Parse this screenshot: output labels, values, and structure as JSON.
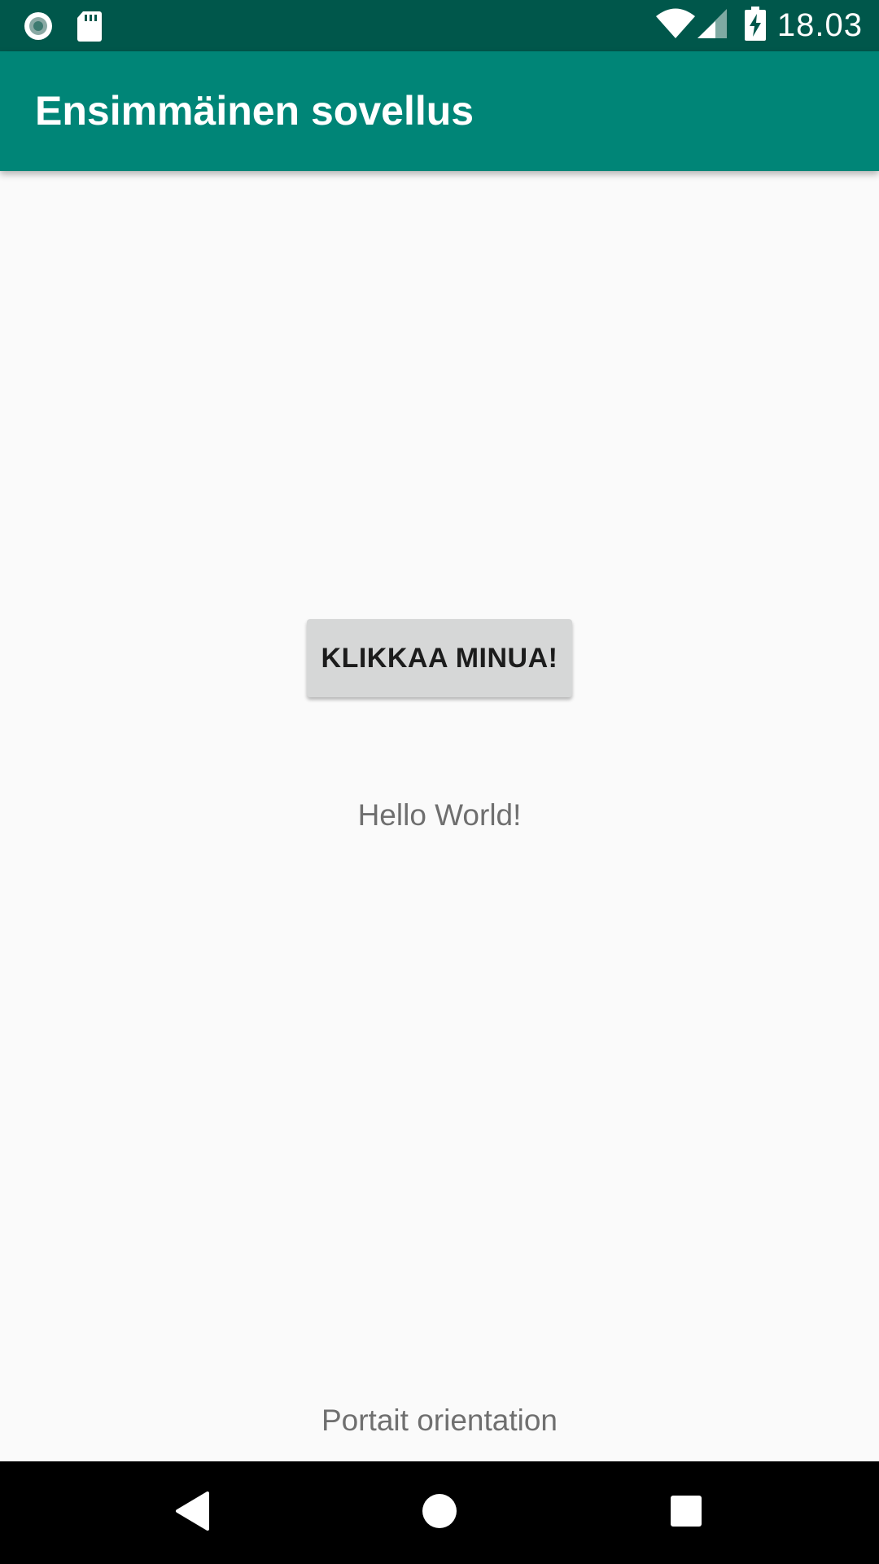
{
  "status_bar": {
    "time": "18.03",
    "left_icons": [
      "radio-button-icon",
      "sd-card-icon"
    ],
    "right_icons": [
      "wifi-icon",
      "signal-icon",
      "battery-charging-icon"
    ],
    "background": "#00574b"
  },
  "app_bar": {
    "title": "Ensimmäinen sovellus",
    "background": "#008577"
  },
  "main": {
    "button_label": "KLIKKAA MINUA!",
    "hello_text": "Hello World!",
    "orientation_text": "Portait orientation"
  },
  "nav_bar": {
    "buttons": [
      "back-icon",
      "home-icon",
      "recents-icon"
    ]
  }
}
